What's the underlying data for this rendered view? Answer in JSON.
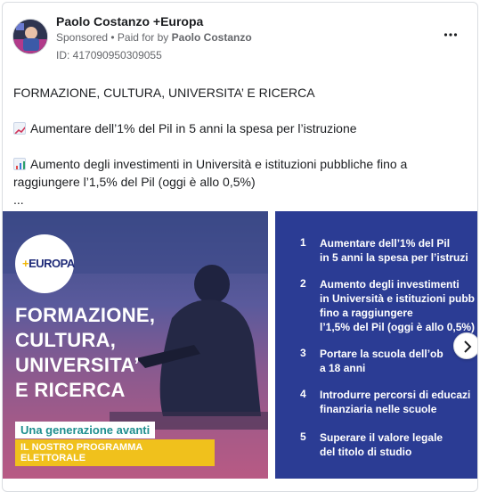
{
  "ad": {
    "page_name": "Paolo Costanzo +Europa",
    "sponsored_label": "Sponsored",
    "separator": " • ",
    "paid_for_label": "Paid for by",
    "paid_for_name": "Paolo Costanzo",
    "ad_id": "ID: 417090950309055",
    "more_icon": "more-horizontal-icon"
  },
  "post": {
    "line1": "FORMAZIONE, CULTURA, UNIVERSITA’ E RICERCA",
    "line2": "Aumentare dell’1% del Pil in 5 anni la spesa per l’istruzione",
    "line3a": "Aumento degli investimenti in Università e istituzioni pubbliche fino a",
    "line3b": "raggiungere l’1,5% del Pil (oggi è allo 0,5%)",
    "ellipsis": "...",
    "emoji1": "chart-increasing-icon",
    "emoji2": "bar-chart-icon"
  },
  "slide1": {
    "logo_text": "EUROPA",
    "logo_plus": "+",
    "headline": [
      "FORMAZIONE,",
      "CULTURA,",
      "UNIVERSITA’",
      "E RICERCA"
    ],
    "tagline": "Una generazione avanti",
    "program": "IL NOSTRO PROGRAMMA ELETTORALE"
  },
  "slide2": {
    "items": [
      {
        "num": "1",
        "text": "Aumentare dell’1% del Pil\nin 5 anni la spesa per l’istruzi"
      },
      {
        "num": "2",
        "text": "Aumento degli investimenti\nin Università e istituzioni pubb\nfino a raggiungere\nl’1,5% del Pil (oggi è allo 0,5%)"
      },
      {
        "num": "3",
        "text": "Portare la scuola dell’ob\na 18 anni"
      },
      {
        "num": "4",
        "text": "Introdurre percorsi di educazi\nfinanziaria nelle scuole"
      },
      {
        "num": "5",
        "text": "Superare il valore legale\ndel titolo di studio"
      }
    ]
  },
  "carousel": {
    "next_icon": "chevron-right-icon"
  },
  "colors": {
    "slide2_bg": "#2b3c94",
    "tagline_text": "#1f8f8f",
    "program_bg": "#f0c11c"
  }
}
